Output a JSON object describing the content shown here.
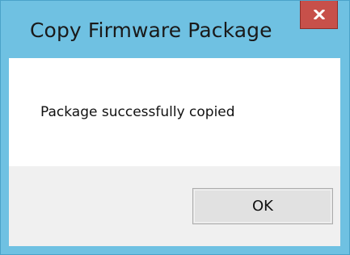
{
  "dialog": {
    "title": "Copy Firmware Package",
    "message": "Package successfully copied",
    "ok_label": "OK",
    "close_icon": "close-icon"
  },
  "colors": {
    "frame": "#6fc1e2",
    "close_button": "#c7504a",
    "client_background": "#f0f0f0",
    "message_background": "#ffffff",
    "button_background": "#e1e1e1"
  }
}
